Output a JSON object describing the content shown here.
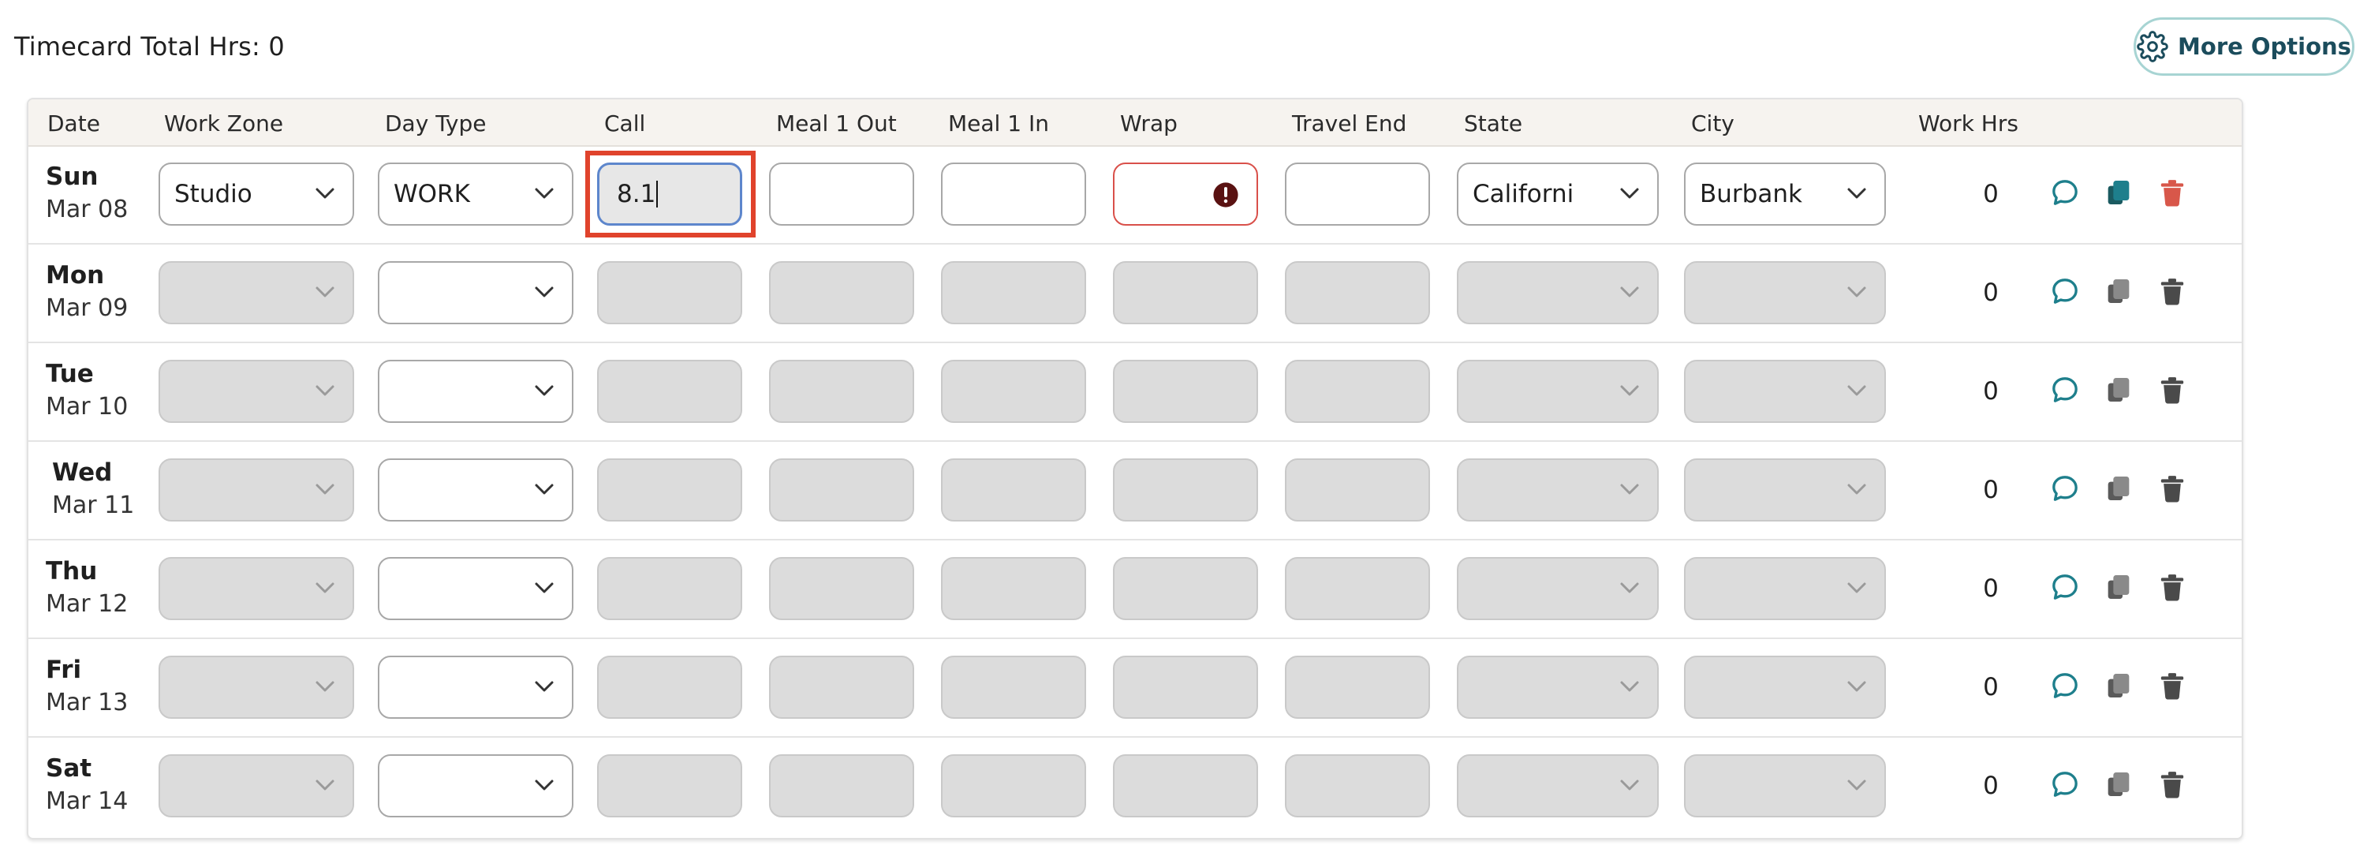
{
  "header": {
    "title": "Timecard Total Hrs: 0",
    "more_options_label": "More Options"
  },
  "columns": [
    "Date",
    "Work Zone",
    "Day Type",
    "Call",
    "Meal 1 Out",
    "Meal 1 In",
    "Wrap",
    "Travel End",
    "State",
    "City",
    "Work Hrs"
  ],
  "rows": [
    {
      "day": "Sun",
      "date": "Mar 08",
      "work_zone": "Studio",
      "day_type": "WORK",
      "call": "8.1",
      "meal1_out": "",
      "meal1_in": "",
      "wrap": "",
      "travel_end": "",
      "state": "Californi",
      "city": "Burbank",
      "work_hrs": "0"
    },
    {
      "day": "Mon",
      "date": "Mar 09",
      "work_zone": "",
      "day_type": "",
      "call": "",
      "meal1_out": "",
      "meal1_in": "",
      "wrap": "",
      "travel_end": "",
      "state": "",
      "city": "",
      "work_hrs": "0"
    },
    {
      "day": "Tue",
      "date": "Mar 10",
      "work_zone": "",
      "day_type": "",
      "call": "",
      "meal1_out": "",
      "meal1_in": "",
      "wrap": "",
      "travel_end": "",
      "state": "",
      "city": "",
      "work_hrs": "0"
    },
    {
      "day": "Wed",
      "date": "Mar 11",
      "work_zone": "",
      "day_type": "",
      "call": "",
      "meal1_out": "",
      "meal1_in": "",
      "wrap": "",
      "travel_end": "",
      "state": "",
      "city": "",
      "work_hrs": "0"
    },
    {
      "day": "Thu",
      "date": "Mar 12",
      "work_zone": "",
      "day_type": "",
      "call": "",
      "meal1_out": "",
      "meal1_in": "",
      "wrap": "",
      "travel_end": "",
      "state": "",
      "city": "",
      "work_hrs": "0"
    },
    {
      "day": "Fri",
      "date": "Mar 13",
      "work_zone": "",
      "day_type": "",
      "call": "",
      "meal1_out": "",
      "meal1_in": "",
      "wrap": "",
      "travel_end": "",
      "state": "",
      "city": "",
      "work_hrs": "0"
    },
    {
      "day": "Sat",
      "date": "Mar 14",
      "work_zone": "",
      "day_type": "",
      "call": "",
      "meal1_out": "",
      "meal1_in": "",
      "wrap": "",
      "travel_end": "",
      "state": "",
      "city": "",
      "work_hrs": "0"
    }
  ],
  "icons": {
    "more_options": "gear-icon",
    "comment": "comment-icon",
    "copy": "copy-icon",
    "delete": "trash-icon",
    "wrap_error": "error-icon",
    "select": "chevron-down-icon"
  },
  "colors": {
    "accent_teal": "#1e7f8c",
    "delete_active": "#d8574a",
    "error_border": "#d9504a",
    "focus_border": "#5d86cc",
    "highlight": "#e0432c"
  }
}
